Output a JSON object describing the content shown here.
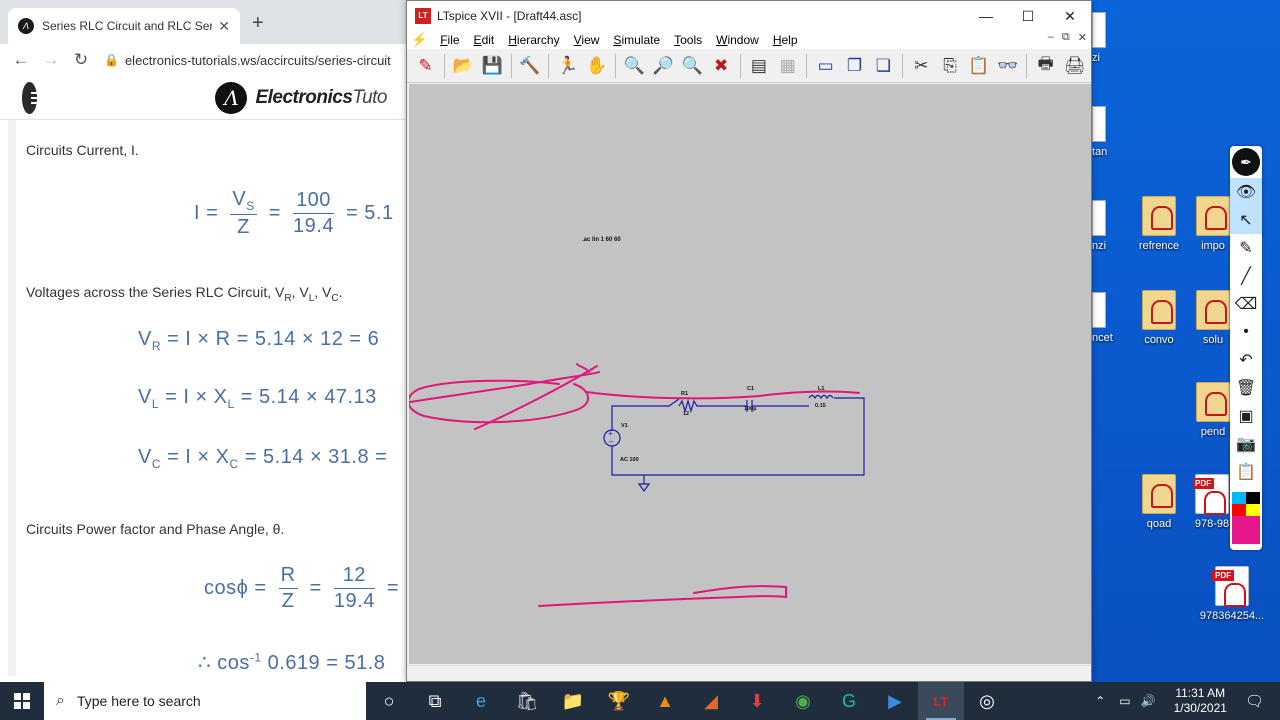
{
  "browser": {
    "tab_title": "Series RLC Circuit and RLC Series",
    "tab_favicon": "Λ",
    "tab_close": "✕",
    "new_tab": "+",
    "url": "electronics-tutorials.ws/accircuits/series-circuit",
    "logo_mark": "Λ",
    "logo_text_bold": "Electronics",
    "logo_text_rest": "Tuto",
    "content": {
      "heading_current": "Circuits Current, I.",
      "eq_current": {
        "lhs": "I =",
        "num1": "V",
        "num1_sub": "S",
        "den1": "Z",
        "eq": "=",
        "num2": "100",
        "den2": "19.4",
        "rhs": "= 5.1"
      },
      "heading_voltages": "Voltages across the Series RLC Circuit, V",
      "heading_voltages_subs": [
        "R",
        "L",
        "C"
      ],
      "eq_vr": {
        "lhs": "V",
        "sub": "R",
        "rest": " = I × R = 5.14 × 12 = 6"
      },
      "eq_vl": {
        "lhs": "V",
        "sub": "L",
        "rest": " = I × X",
        "sub2": "L",
        "rest2": " = 5.14 × 47.13"
      },
      "eq_vc": {
        "lhs": "V",
        "sub": "C",
        "rest": " = I × X",
        "sub2": "C",
        "rest2": " = 5.14 × 31.8 ="
      },
      "heading_power": "Circuits Power factor and Phase Angle, θ.",
      "eq_cos": {
        "lhs": "cosϕ =",
        "num1": "R",
        "den1": "Z",
        "eq": "=",
        "num2": "12",
        "den2": "19.4",
        "rhs": "="
      },
      "eq_acos": {
        "prefix": "∴ cos",
        "sup": "-1",
        "rest": " 0.619 = 51.8"
      }
    }
  },
  "ltspice": {
    "title": "LTspice XVII - [Draft44.asc]",
    "app_icon": "LT",
    "menu": [
      "File",
      "Edit",
      "Hierarchy",
      "View",
      "Simulate",
      "Tools",
      "Window",
      "Help"
    ],
    "menu_underline": [
      "F",
      "E",
      "H",
      "V",
      "S",
      "T",
      "W",
      "H"
    ],
    "mdi_controls": [
      "–",
      "⧉",
      "✕"
    ],
    "window_controls": [
      "—",
      "☐",
      "✕"
    ],
    "toolbar_icons": [
      {
        "name": "new-schematic-icon",
        "glyph": "✎",
        "tone": "red"
      },
      {
        "name": "open-icon",
        "glyph": "📂",
        "tone": ""
      },
      {
        "name": "save-icon",
        "glyph": "💾",
        "tone": ""
      },
      {
        "name": "control-panel-icon",
        "glyph": "🔨",
        "tone": ""
      },
      {
        "name": "run-icon",
        "glyph": "🏃",
        "tone": ""
      },
      {
        "name": "halt-icon",
        "glyph": "✋",
        "tone": "dim"
      },
      {
        "name": "zoom-in-icon",
        "glyph": "🔍",
        "tone": ""
      },
      {
        "name": "pan-icon",
        "glyph": "🔎",
        "tone": "dim"
      },
      {
        "name": "zoom-out-icon",
        "glyph": "🔍",
        "tone": ""
      },
      {
        "name": "zoom-fit-icon",
        "glyph": "✖",
        "tone": "red"
      },
      {
        "name": "autorange-icon",
        "glyph": "▤",
        "tone": ""
      },
      {
        "name": "grid-icon",
        "glyph": "▦",
        "tone": "dim"
      },
      {
        "name": "tile-horizontal-icon",
        "glyph": "▭",
        "tone": "blue"
      },
      {
        "name": "cascade-icon",
        "glyph": "❐",
        "tone": "blue"
      },
      {
        "name": "tile-vertical-icon",
        "glyph": "❏",
        "tone": "blue"
      },
      {
        "name": "cut-icon",
        "glyph": "✂",
        "tone": ""
      },
      {
        "name": "copy-icon",
        "glyph": "⎘",
        "tone": ""
      },
      {
        "name": "paste-icon",
        "glyph": "📋",
        "tone": "dim"
      },
      {
        "name": "find-icon",
        "glyph": "👓",
        "tone": ""
      },
      {
        "name": "print-preview-icon",
        "glyph": "🖶",
        "tone": ""
      },
      {
        "name": "print-icon",
        "glyph": "🖨",
        "tone": ""
      }
    ],
    "schematic": {
      "directive": ".ac lin 1 60 60",
      "r_name": "R1",
      "r_value": "12",
      "c_name": "C1",
      "c_value": "100μ",
      "l_name": "L1",
      "l_value": "0.15",
      "v_name": "V1",
      "v_value": "AC 100",
      "wire_color": "#1a1aa8",
      "ink_color": "#e0177a"
    }
  },
  "desktop": {
    "icons": [
      {
        "label": "refrence",
        "type": "folder"
      },
      {
        "label": "impo",
        "type": "folder"
      },
      {
        "label": "convo",
        "type": "folder"
      },
      {
        "label": "solu",
        "type": "folder"
      },
      {
        "label": "pend",
        "type": "folder"
      },
      {
        "label": "qoad",
        "type": "folder"
      },
      {
        "label": "978-98",
        "type": "pdf"
      },
      {
        "label": "978364254...",
        "type": "pdf"
      }
    ],
    "partial_labels": [
      "zi",
      "tan",
      "nzi",
      "ncet"
    ]
  },
  "annotation_toolbar": {
    "tools": [
      "pen-icon",
      "eye-icon",
      "pointer-icon",
      "highlighter-icon",
      "line-icon",
      "eraser-icon",
      "dot-icon",
      "undo-icon",
      "trash-icon",
      "screen-icon",
      "camera-icon",
      "clipboard-icon"
    ],
    "colors": [
      "#00b7ff",
      "#000000",
      "#ff0000",
      "#ffff00",
      "#e6178a"
    ]
  },
  "taskbar": {
    "search_placeholder": "Type here to search",
    "time": "11:31 AM",
    "date": "1/30/2021",
    "apps": [
      "cortana-icon",
      "task-view-icon",
      "edge-icon",
      "store-icon",
      "file-explorer-icon",
      "app-icon",
      "vlc-icon",
      "matlab-icon",
      "download-icon",
      "chrome-icon",
      "grammarly-icon",
      "video-icon",
      "ltspice-icon",
      "obs-icon"
    ]
  }
}
